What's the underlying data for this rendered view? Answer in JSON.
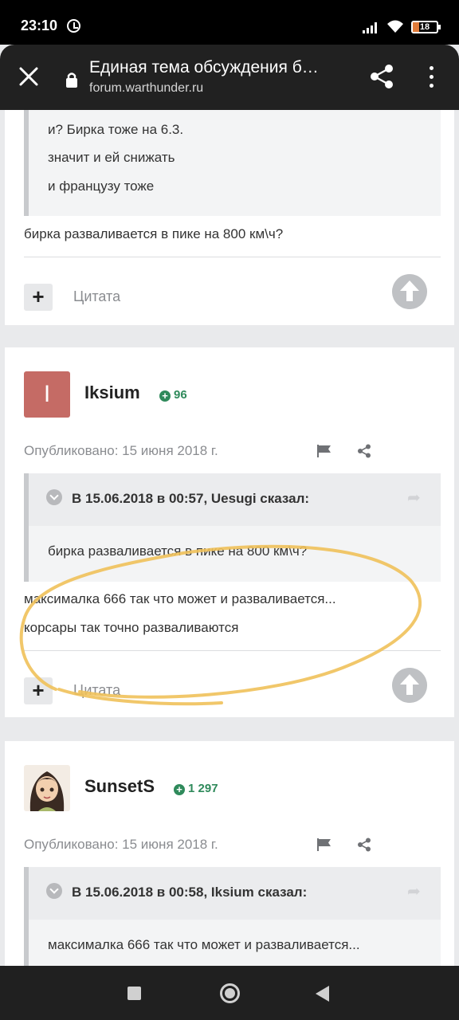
{
  "status_bar": {
    "time": "23:10",
    "battery": "18",
    "colors": {
      "battery_low": "#e07b3a"
    }
  },
  "browser": {
    "title": "Единая тема обсуждения б…",
    "url": "forum.warthunder.ru"
  },
  "post_top": {
    "quote_lines": [
      "и? Бирка тоже на 6.3.",
      "значит и ей снижать",
      "и французу тоже"
    ],
    "body": "бирка разваливается в пике на 800 км\\ч?",
    "add_label": "+",
    "quote_label": "Цитата"
  },
  "post_iksium": {
    "avatar_letter": "I",
    "username": "Iksium",
    "reputation": "96",
    "published": "Опубликовано: 15 июня 2018 г.",
    "quote": {
      "citation": "В 15.06.2018 в 00:57, Uesugi сказал:",
      "text": "бирка разваливается в пике на 800 км\\ч?"
    },
    "body_lines": [
      "максималка 666 так что может и разваливается...",
      "корсары так точно разваливаются"
    ],
    "add_label": "+",
    "quote_label": "Цитата"
  },
  "post_sunsets": {
    "username": "SunsetS",
    "reputation": "1 297",
    "published": "Опубликовано: 15 июня 2018 г.",
    "quote": {
      "citation": "В 15.06.2018 в 00:58, Iksium сказал:",
      "text": "максималка 666 так что может и разваливается..."
    }
  },
  "colors": {
    "avatar_iksium": "#c56b65",
    "reputation": "#2f8a5b",
    "annotation_stroke": "#f0c15a"
  }
}
